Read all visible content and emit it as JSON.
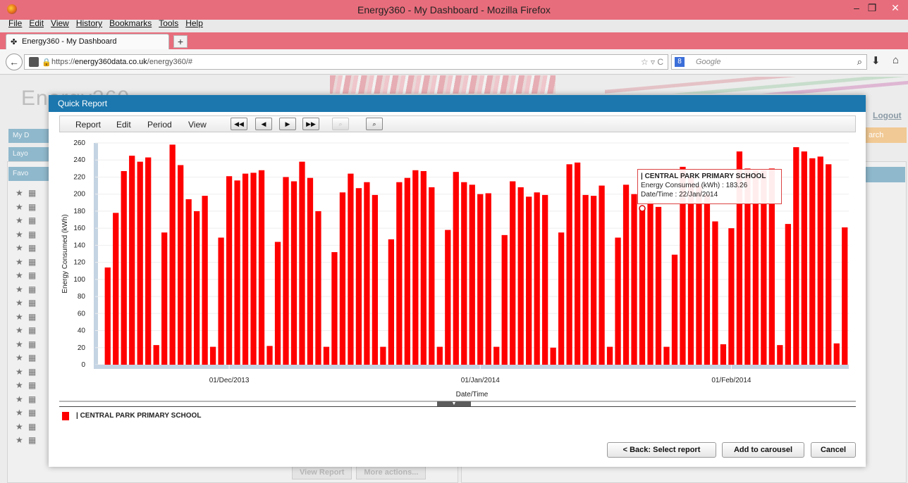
{
  "browser": {
    "window_title": "Energy360 - My Dashboard - Mozilla Firefox",
    "menu": [
      "File",
      "Edit",
      "View",
      "History",
      "Bookmarks",
      "Tools",
      "Help"
    ],
    "tab_label": "Energy360 - My Dashboard",
    "new_tab": "+",
    "url_prefix": "https://",
    "url_host": "energy360data.co.uk",
    "url_path": "/energy360/#",
    "search_placeholder": "Google"
  },
  "page": {
    "logo": "Energy360",
    "logout": "Logout",
    "side_buttons": [
      "My D",
      "Layo",
      "Favo"
    ],
    "search_button": "arch",
    "bg_buttons": [
      "View Report",
      "More actions..."
    ]
  },
  "modal": {
    "title": "Quick Report",
    "menus": [
      "Report",
      "Edit",
      "Period",
      "View"
    ],
    "buttons": {
      "back": "< Back: Select report",
      "add": "Add to carousel",
      "cancel": "Cancel"
    },
    "tooltip": {
      "series": "| CENTRAL PARK PRIMARY SCHOOL",
      "value_line": "Energy Consumed (kWh) : 183.26",
      "date_line": "Date/Time : 22/Jan/2014"
    },
    "legend": "| CENTRAL PARK PRIMARY SCHOOL"
  },
  "colors": {
    "bar": "#ff0000",
    "header": "#1b77ae",
    "firefox_titlebar": "#e86d7c"
  },
  "chart_data": {
    "type": "bar",
    "ylabel": "Energy Consumed (kWh)",
    "xlabel": "Date/Time",
    "ylim": [
      0,
      260
    ],
    "yticks": [
      0,
      20,
      40,
      60,
      80,
      100,
      120,
      140,
      160,
      180,
      200,
      220,
      240,
      260
    ],
    "x_tick_labels": [
      "01/Dec/2013",
      "01/Jan/2014",
      "01/Feb/2014"
    ],
    "x_tick_index": [
      15,
      46,
      77
    ],
    "series": [
      {
        "name": "| CENTRAL PARK PRIMARY SCHOOL",
        "values": [
          114,
          178,
          227,
          245,
          238,
          243,
          23,
          155,
          258,
          234,
          194,
          180,
          198,
          21,
          149,
          221,
          216,
          224,
          225,
          228,
          22,
          144,
          220,
          215,
          238,
          219,
          180,
          21,
          132,
          202,
          224,
          207,
          214,
          199,
          21,
          147,
          214,
          219,
          228,
          227,
          208,
          21,
          158,
          226,
          214,
          211,
          200,
          201,
          21,
          152,
          215,
          208,
          197,
          202,
          199,
          20,
          155,
          235,
          237,
          199,
          198,
          210,
          21,
          149,
          211,
          200,
          183.26,
          192,
          185,
          21,
          129,
          232,
          220,
          210,
          200,
          168,
          24,
          160,
          250,
          230,
          228,
          228,
          230,
          23,
          165,
          255,
          250,
          242,
          244,
          235,
          25,
          161
        ]
      }
    ]
  }
}
